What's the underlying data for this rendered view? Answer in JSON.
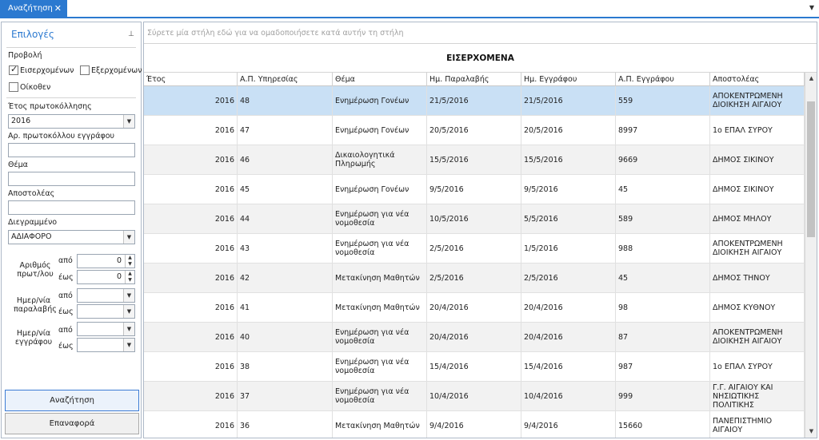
{
  "tab": {
    "label": "Αναζήτηση",
    "close": "✕",
    "menu": "▼"
  },
  "left": {
    "title": "Επιλογές",
    "pin": "📌",
    "view_label": "Προβολή",
    "incoming_label": "Εισερχομένων",
    "outgoing_label": "Εξερχομένων",
    "internal_label": "Οίκοθεν",
    "year_label": "Έτος πρωτοκόλλησης",
    "year_value": "2016",
    "docnum_label": "Αρ. πρωτοκόλλου εγγράφου",
    "docnum_value": "",
    "subject_label": "Θέμα",
    "subject_value": "",
    "sender_label": "Αποστολέας",
    "sender_value": "",
    "deleted_label": "Διεγραμμένο",
    "deleted_value": "ΑΔΙΑΦΟΡΟ",
    "protnum_label_1": "Αριθμός",
    "protnum_label_2": "πρωτ/λου",
    "recdate_label_1": "Ημερ/νία",
    "recdate_label_2": "παραλαβής",
    "docdate_label_1": "Ημερ/νία",
    "docdate_label_2": "εγγράφου",
    "from_label": "από",
    "to_label": "έως",
    "protnum_from": "0",
    "protnum_to": "0",
    "search_button": "Αναζήτηση",
    "reset_button": "Επαναφορά"
  },
  "grid": {
    "group_hint": "Σύρετε μία στήλη εδώ για να ομαδοποιήσετε κατά αυτήν τη στήλη",
    "banner": "ΕΙΣΕΡΧΟΜΕΝΑ",
    "columns": [
      "Έτος",
      "Α.Π. Υπηρεσίας",
      "Θέμα",
      "Ημ. Παραλαβής",
      "Ημ. Εγγράφου",
      "Α.Π. Εγγράφου",
      "Αποστολέας"
    ],
    "rows": [
      [
        "2016",
        "48",
        "Ενημέρωση Γονέων",
        "21/5/2016",
        "21/5/2016",
        "559",
        "ΑΠΟΚΕΝΤΡΩΜΕΝΗ ΔΙΟΙΚΗΣΗ ΑΙΓΑΙΟΥ"
      ],
      [
        "2016",
        "47",
        "Ενημέρωση Γονέων",
        "20/5/2016",
        "20/5/2016",
        "8997",
        "1ο ΕΠΑΛ ΣΥΡΟΥ"
      ],
      [
        "2016",
        "46",
        "Δικαιολογητικά Πληρωμής",
        "15/5/2016",
        "15/5/2016",
        "9669",
        "ΔΗΜΟΣ ΣΙΚΙΝΟΥ"
      ],
      [
        "2016",
        "45",
        "Ενημέρωση Γονέων",
        "9/5/2016",
        "9/5/2016",
        "45",
        "ΔΗΜΟΣ ΣΙΚΙΝΟΥ"
      ],
      [
        "2016",
        "44",
        "Ενημέρωση για νέα νομοθεσία",
        "10/5/2016",
        "5/5/2016",
        "589",
        "ΔΗΜΟΣ ΜΗΛΟΥ"
      ],
      [
        "2016",
        "43",
        "Ενημέρωση για νέα νομοθεσία",
        "2/5/2016",
        "1/5/2016",
        "988",
        "ΑΠΟΚΕΝΤΡΩΜΕΝΗ ΔΙΟΙΚΗΣΗ ΑΙΓΑΙΟΥ"
      ],
      [
        "2016",
        "42",
        "Μετακίνηση Μαθητών",
        "2/5/2016",
        "2/5/2016",
        "45",
        "ΔΗΜΟΣ ΤΗΝΟΥ"
      ],
      [
        "2016",
        "41",
        "Μετακίνηση Μαθητών",
        "20/4/2016",
        "20/4/2016",
        "98",
        "ΔΗΜΟΣ ΚΥΘΝΟΥ"
      ],
      [
        "2016",
        "40",
        "Ενημέρωση για νέα νομοθεσία",
        "20/4/2016",
        "20/4/2016",
        "87",
        "ΑΠΟΚΕΝΤΡΩΜΕΝΗ ΔΙΟΙΚΗΣΗ ΑΙΓΑΙΟΥ"
      ],
      [
        "2016",
        "38",
        "Ενημέρωση για νέα νομοθεσία",
        "15/4/2016",
        "15/4/2016",
        "987",
        "1ο ΕΠΑΛ ΣΥΡΟΥ"
      ],
      [
        "2016",
        "37",
        "Ενημέρωση για νέα νομοθεσία",
        "10/4/2016",
        "10/4/2016",
        "999",
        "Γ.Γ. ΑΙΓΑΙΟΥ ΚΑΙ ΝΗΣΙΩΤΙΚΗΣ ΠΟΛΙΤΙΚΗΣ"
      ],
      [
        "2016",
        "36",
        "Μετακίνηση Μαθητών",
        "9/4/2016",
        "9/4/2016",
        "15660",
        "ΠΑΝΕΠΙΣΤΗΜΙΟ ΑΙΓΑΙΟΥ"
      ]
    ]
  },
  "colors": {
    "accent": "#2b79d0",
    "selected_row": "#c9e0f5",
    "alt_row": "#f2f2f2"
  }
}
